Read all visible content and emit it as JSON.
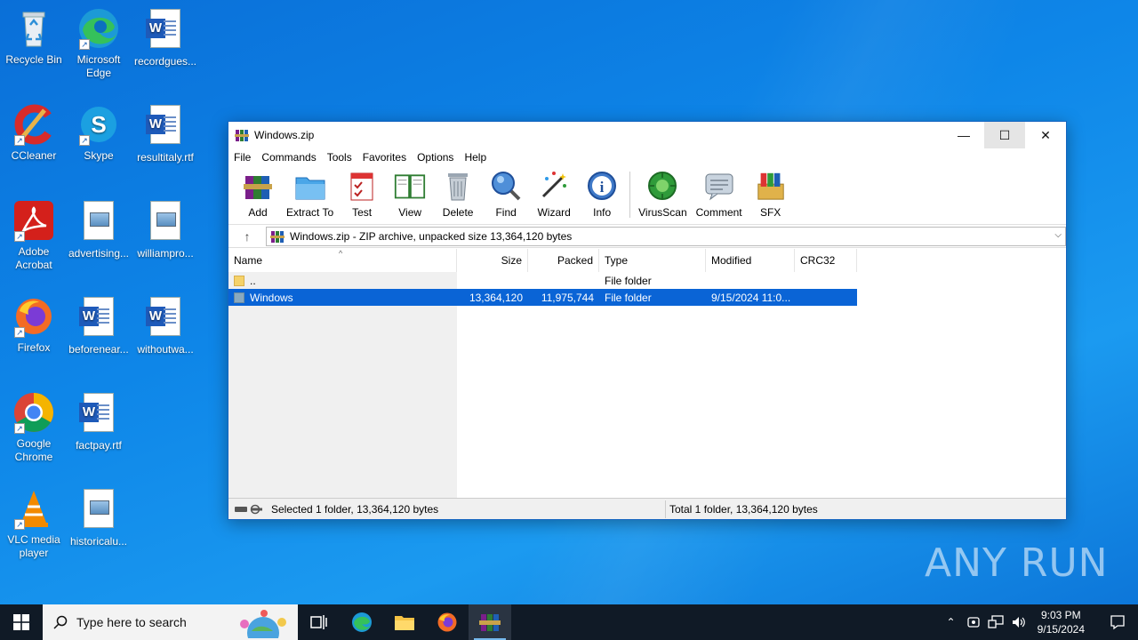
{
  "desktop": {
    "icons": [
      {
        "label": "Recycle Bin",
        "icon": "recycle-bin-icon"
      },
      {
        "label": "Microsoft Edge",
        "icon": "edge-icon"
      },
      {
        "label": "recordgues...",
        "icon": "word-doc-icon"
      },
      {
        "label": "CCleaner",
        "icon": "ccleaner-icon"
      },
      {
        "label": "Skype",
        "icon": "skype-icon"
      },
      {
        "label": "resultitaly.rtf",
        "icon": "word-doc-icon"
      },
      {
        "label": "Adobe Acrobat",
        "icon": "acrobat-icon"
      },
      {
        "label": "advertising...",
        "icon": "image-file-icon"
      },
      {
        "label": "williampro...",
        "icon": "image-file-icon"
      },
      {
        "label": "Firefox",
        "icon": "firefox-icon"
      },
      {
        "label": "beforenear...",
        "icon": "word-doc-icon"
      },
      {
        "label": "withoutwa...",
        "icon": "word-doc-icon"
      },
      {
        "label": "Google Chrome",
        "icon": "chrome-icon"
      },
      {
        "label": "factpay.rtf",
        "icon": "word-doc-icon"
      },
      {
        "label": "VLC media player",
        "icon": "vlc-icon"
      },
      {
        "label": "historicalu...",
        "icon": "image-file-icon"
      }
    ]
  },
  "window": {
    "title": "Windows.zip",
    "menu": [
      "File",
      "Commands",
      "Tools",
      "Favorites",
      "Options",
      "Help"
    ],
    "toolbar": [
      "Add",
      "Extract To",
      "Test",
      "View",
      "Delete",
      "Find",
      "Wizard",
      "Info",
      "VirusScan",
      "Comment",
      "SFX"
    ],
    "path": "Windows.zip - ZIP archive, unpacked size 13,364,120 bytes",
    "columns": [
      "Name",
      "Size",
      "Packed",
      "Type",
      "Modified",
      "CRC32"
    ],
    "rows": [
      {
        "name": "..",
        "size": "",
        "packed": "",
        "type": "File folder",
        "modified": "",
        "crc": ""
      },
      {
        "name": "Windows",
        "size": "13,364,120",
        "packed": "11,975,744",
        "type": "File folder",
        "modified": "9/15/2024 11:0...",
        "crc": ""
      }
    ],
    "status_left": "Selected 1 folder, 13,364,120 bytes",
    "status_right": "Total 1 folder, 13,364,120 bytes"
  },
  "taskbar": {
    "search_placeholder": "Type here to search",
    "time": "9:03 PM",
    "date": "9/15/2024"
  },
  "watermark": "ANY RUN"
}
